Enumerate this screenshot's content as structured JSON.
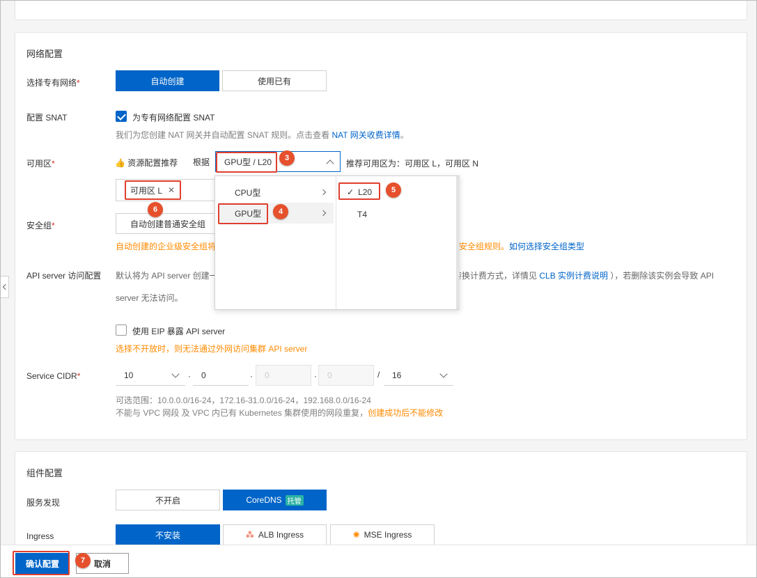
{
  "network": {
    "section_title": "网络配置",
    "vpc_label": "选择专有网络",
    "vpc_auto": "自动创建",
    "vpc_existing": "使用已有",
    "snat_label": "配置 SNAT",
    "snat_checkbox": "为专有网络配置 SNAT",
    "snat_hint": "我们为您创建 NAT 网关并自动配置 SNAT 规则。点击查看",
    "snat_link": "NAT 网关收费详情",
    "snat_hint_end": "。",
    "zone_label": "可用区",
    "zone_recommend": "资源配置推荐",
    "zone_basis": "根据",
    "zone_select_value": "GPU型 / L20",
    "zone_recommend_text": "推荐可用区为：可用区 L，可用区 N",
    "zone_tag": "可用区 L",
    "sg_label": "安全组",
    "sg_button": "自动创建普通安全组",
    "sg_warn": "自动创建的企业级安全组将",
    "sg_warn_tail": "安全组规则。",
    "sg_link": "如何选择安全组类型",
    "api_label": "API server 访问配置",
    "api_hint_1": "默认将为 API server 创建一",
    "api_hint_2": "转换计费方式，详情见",
    "api_link": "CLB 实例计费说明",
    "api_hint_3": "），若删除该实例会导致 API",
    "api_hint_4": "server 无法访问。",
    "eip_checkbox": "使用 EIP 暴露 API server",
    "eip_warn": "选择不开放时，则无法通过外网访问集群 API server",
    "cidr_label": "Service CIDR",
    "cidr_values": [
      "10",
      "0",
      "0",
      "0",
      "16"
    ],
    "cidr_dot": "·",
    "cidr_slash": "/",
    "cidr_range": "可选范围：10.0.0.0/16-24，172.16-31.0.0/16-24，192.168.0.0/16-24",
    "cidr_note": "不能与 VPC 网段 及 VPC 内已有 Kubernetes 集群使用的网段重复，",
    "cidr_note_warn": "创建成功后不能修改"
  },
  "dropdown": {
    "type_options": [
      "CPU型",
      "GPU型"
    ],
    "gpu_options": [
      "L20",
      "T4"
    ]
  },
  "components": {
    "section_title": "组件配置",
    "service_label": "服务发现",
    "service_off": "不开启",
    "service_coredns": "CoreDNS",
    "service_badge": "托管",
    "ingress_label": "Ingress",
    "ingress_none": "不安装",
    "ingress_alb": "ALB Ingress",
    "ingress_mse": "MSE Ingress"
  },
  "footer": {
    "confirm": "确认配置",
    "cancel": "取消"
  },
  "annotations": [
    "3",
    "4",
    "5",
    "6",
    "7"
  ],
  "colors": {
    "primary": "#0064c8",
    "warn": "#ff8a00",
    "annotation": "#e6502d"
  }
}
